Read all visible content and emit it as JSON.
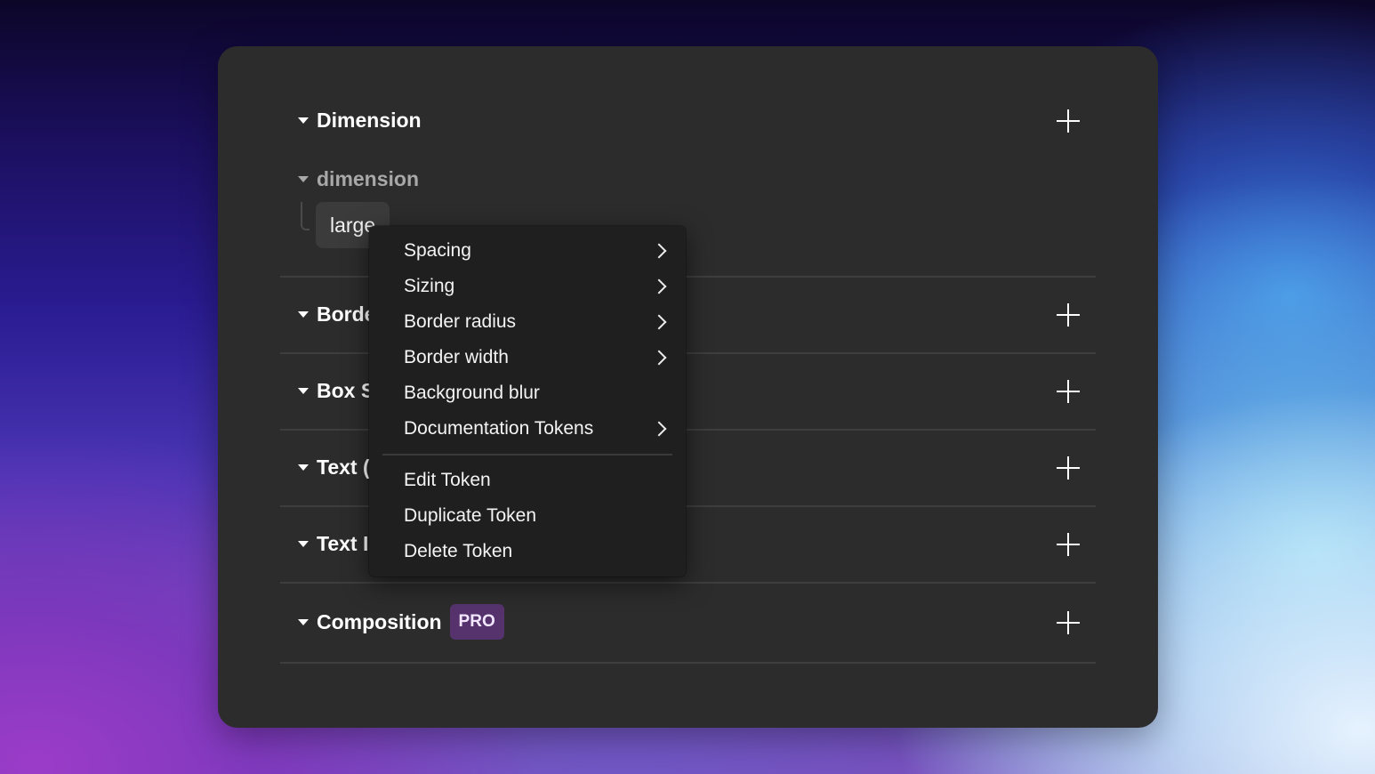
{
  "sections": [
    {
      "title": "Dimension"
    },
    {
      "title": "Borde"
    },
    {
      "title": "Box S"
    },
    {
      "title": "Text ("
    },
    {
      "title": "Text I"
    },
    {
      "title": "Composition",
      "badge": "PRO"
    }
  ],
  "dimension_group": {
    "name": "dimension",
    "token": "large"
  },
  "context_menu": {
    "items": [
      {
        "label": "Spacing",
        "submenu": true
      },
      {
        "label": "Sizing",
        "submenu": true
      },
      {
        "label": "Border radius",
        "submenu": true
      },
      {
        "label": "Border width",
        "submenu": true
      },
      {
        "label": "Background blur",
        "submenu": false
      },
      {
        "label": "Documentation Tokens",
        "submenu": true
      }
    ],
    "actions": [
      {
        "label": "Edit Token"
      },
      {
        "label": "Duplicate Token"
      },
      {
        "label": "Delete Token"
      }
    ]
  },
  "icons": {
    "collapse": "caret-down-icon",
    "add": "plus-icon",
    "submenu": "chevron-right-icon"
  },
  "colors": {
    "panel": "#2c2c2c",
    "menu": "#1f1f1f",
    "pro_badge": "#56336d"
  }
}
